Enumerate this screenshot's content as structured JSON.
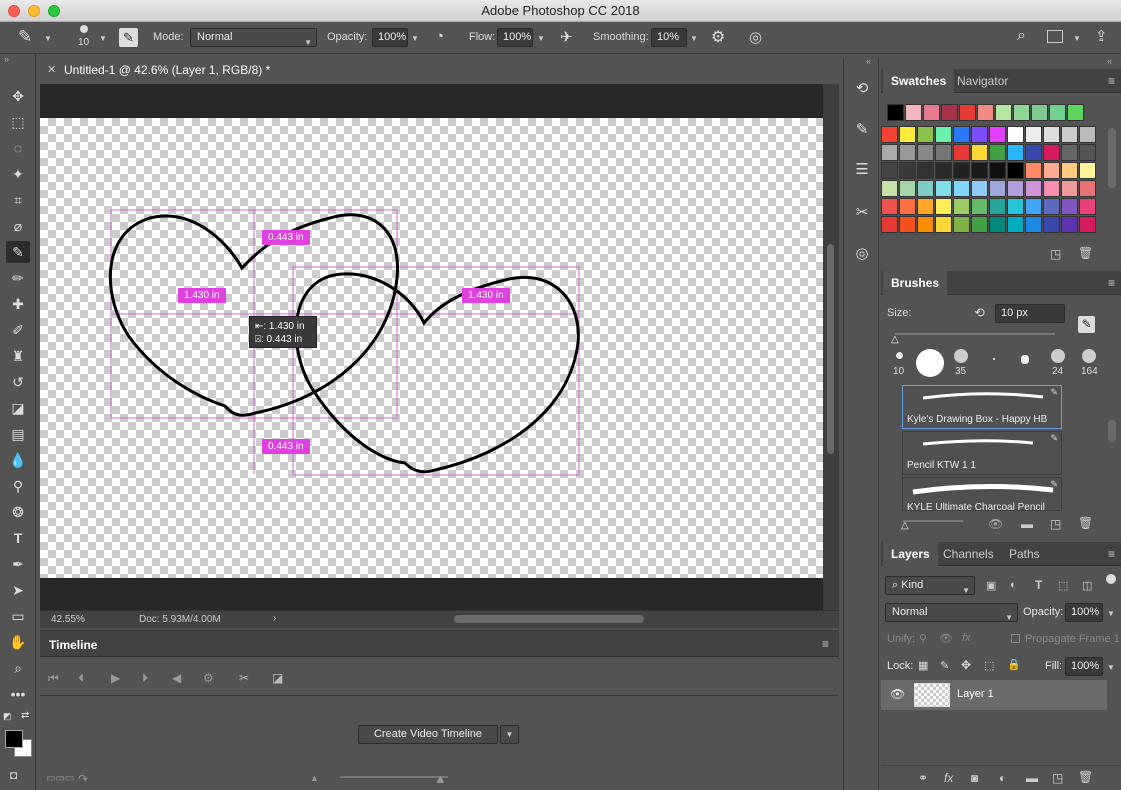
{
  "app": {
    "window_title": "Adobe Photoshop CC 2018"
  },
  "options": {
    "brush_size": "10",
    "mode_label": "Mode:",
    "mode_value": "Normal",
    "opacity_label": "Opacity:",
    "opacity_value": "100%",
    "flow_label": "Flow:",
    "flow_value": "100%",
    "smoothing_label": "Smoothing:",
    "smoothing_value": "10%"
  },
  "document": {
    "tab_title": "Untitled-1 @ 42.6% (Layer 1, RGB/8) *",
    "zoom": "42.55%",
    "doc_info": "Doc: 5.93M/4.00M"
  },
  "canvas": {
    "measure_top": "0.443 in",
    "measure_bottom": "0.443 in",
    "measure_left": "1.430 in",
    "measure_right": "1.430 in",
    "tooltip_w": "⇤: 1.430 in",
    "tooltip_h": "⍓: 0.443 in"
  },
  "timeline": {
    "title": "Timeline",
    "create_button": "Create Video Timeline"
  },
  "swatches": {
    "tabs": [
      "Swatches",
      "Navigator"
    ],
    "top_row": [
      "#000000",
      "#f4b6c2",
      "#e87a8f",
      "#a8324a",
      "#e53935",
      "#f28b82",
      "#b5e7a0",
      "#8fd694",
      "#7ecb8f",
      "#6fd18f",
      "#5ed65e"
    ],
    "rows": [
      [
        "#f44336",
        "#ffeb3b",
        "#8bc34a",
        "#69f0ae",
        "#2979ff",
        "#7c4dff",
        "#e040fb",
        "#ffffff",
        "#eeeeee",
        "#dddddd",
        "#cccccc",
        "#bbbbbb"
      ],
      [
        "#aaaaaa",
        "#999999",
        "#888888",
        "#777777",
        "#e53935",
        "#fdd835",
        "#43a047",
        "#29b6f6",
        "#3949ab",
        "#d81b60",
        "#666666",
        "#555555"
      ],
      [
        "#444444",
        "#3a3a3a",
        "#333333",
        "#2a2a2a",
        "#222222",
        "#1a1a1a",
        "#111111",
        "#000000",
        "#ff8a65",
        "#ffab91",
        "#ffcc80",
        "#fff59d"
      ],
      [
        "#c5e1a5",
        "#a5d6a7",
        "#80cbc4",
        "#80deea",
        "#81d4fa",
        "#90caf9",
        "#9fa8da",
        "#b39ddb",
        "#ce93d8",
        "#f48fb1",
        "#ef9a9a",
        "#e57373"
      ],
      [
        "#ef5350",
        "#ff7043",
        "#ffa726",
        "#ffee58",
        "#9ccc65",
        "#66bb6a",
        "#26a69a",
        "#26c6da",
        "#42a5f5",
        "#5c6bc0",
        "#7e57c2",
        "#ec407a"
      ],
      [
        "#e53935",
        "#f4511e",
        "#fb8c00",
        "#fdd835",
        "#7cb342",
        "#43a047",
        "#00897b",
        "#00acc1",
        "#1e88e5",
        "#3949ab",
        "#5e35b1",
        "#d81b60"
      ]
    ]
  },
  "brushes": {
    "tab": "Brushes",
    "size_label": "Size:",
    "size_value": "10 px",
    "presets": [
      "10",
      "35",
      "24",
      "164"
    ],
    "list": [
      "Kyle's Drawing Box - Happy HB",
      "Pencil KTW 1 1",
      "KYLE Ultimate Charcoal Pencil"
    ]
  },
  "layers": {
    "tabs": [
      "Layers",
      "Channels",
      "Paths"
    ],
    "kind": "Kind",
    "blend": "Normal",
    "opacity_label": "Opacity:",
    "opacity_value": "100%",
    "unify_label": "Unify:",
    "propagate_label": "Propagate Frame 1",
    "lock_label": "Lock:",
    "fill_label": "Fill:",
    "fill_value": "100%",
    "layer_name": "Layer 1"
  }
}
